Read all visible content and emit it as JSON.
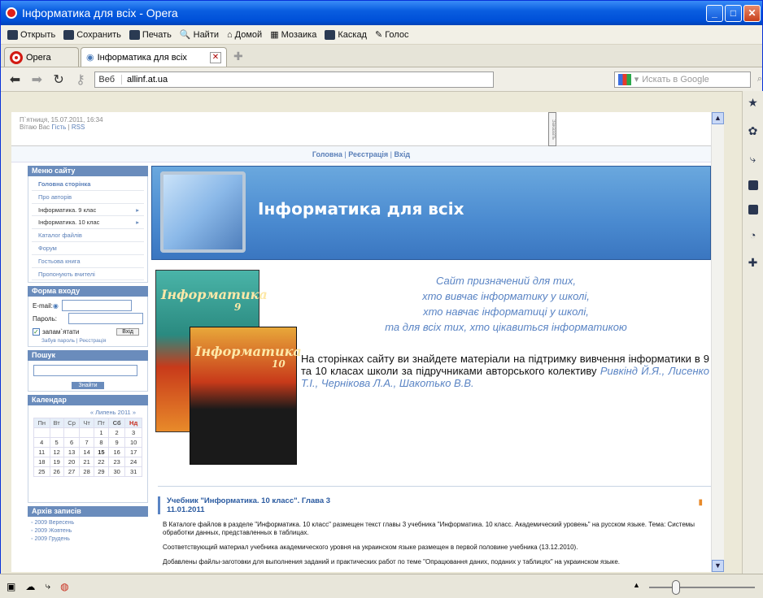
{
  "window": {
    "title": "Інформатика для всіх - Opera"
  },
  "menubar": {
    "items": [
      "Открыть",
      "Сохранить",
      "Печать",
      "Найти",
      "Домой",
      "Мозаика",
      "Каскад",
      "Голос"
    ]
  },
  "tabs": {
    "opera_label": "Opera",
    "page_label": "Інформатика для всіх"
  },
  "nav": {
    "web_label": "Веб",
    "url": "allinf.at.ua",
    "search_placeholder": "Искать в Google"
  },
  "site": {
    "date": "П`ятниця, 15.07.2011, 16:34",
    "greeting": "Вітаю Вас",
    "guest": "Гість",
    "rss": "RSS",
    "vertical_text": "Заказать",
    "topnav": {
      "home": "Головна",
      "register": "Реєстрація",
      "login": "Вхід"
    },
    "menu_title": "Меню сайту",
    "menu": [
      "Головна сторінка",
      "Про авторів",
      "Інформатика. 9 клас",
      "Інформатика. 10 клас",
      "Каталог файлів",
      "Форум",
      "Гостьова книга",
      "Пропонують вчителі"
    ],
    "login_title": "Форма входу",
    "email_label": "E-mail:",
    "password_label": "Пароль:",
    "remember_label": "запам`ятати",
    "login_button": "Вхід",
    "forgot": "Забув пароль",
    "register": "Реєстрація",
    "search_title": "Пошук",
    "search_button": "Знайти",
    "calendar_title": "Календар",
    "calendar_month": "Липень 2011",
    "calendar_days": [
      "Пн",
      "Вт",
      "Ср",
      "Чт",
      "Пт",
      "Сб",
      "Нд"
    ],
    "calendar_rows": [
      [
        "",
        "",
        "",
        "",
        "1",
        "2",
        "3"
      ],
      [
        "4",
        "5",
        "6",
        "7",
        "8",
        "9",
        "10"
      ],
      [
        "11",
        "12",
        "13",
        "14",
        "15",
        "16",
        "17"
      ],
      [
        "18",
        "19",
        "20",
        "21",
        "22",
        "23",
        "24"
      ],
      [
        "25",
        "26",
        "27",
        "28",
        "29",
        "30",
        "31"
      ]
    ],
    "archive_title": "Архів записів",
    "archive": [
      "2009 Вересень",
      "2009 Жовтень",
      "2009 Грудень"
    ],
    "banner_title": "Інформатика для всіх",
    "book1_title": "Інформатика",
    "book1_grade": "9",
    "book2_title": "Інформатика",
    "book2_grade": "10",
    "intro_lines": [
      "Сайт призначений для тих,",
      "хто вивчає інформатику у школі,",
      "хто навчає інформатиці у школі,",
      "та для всіх тих, хто цікавиться інформатикою"
    ],
    "intro_text": "На сторінках сайту ви знайдете матеріали на підтримку вивчення інформатики в 9 та 10 класах школи за підручниками авторського колективу",
    "authors": "Ривкінд Й.Я., Лисенко Т.І., Чернікова Л.А., Шакотько В.В.",
    "news_title": "Учебник \"Информатика. 10 класс\". Глава 3",
    "news_date": "11.01.2011",
    "news_p1": "В Каталоге файлов в разделе \"Информатика. 10 класс\" размещен текст главы 3 учебника \"Информатика. 10 класс. Академический уровень\" на русском языке. Тема: Системы обработки данных, представленных в таблицах.",
    "news_p2": "Соответствующий материал учебника академического уровня на украинском языке размещен в первой половине учебника (13.12.2010).",
    "news_p3": "Добавлены файлы-заготовки для выполнения заданий и практических работ по теме \"Опрацювання даних, поданих у таблицях\" на украинском языке."
  }
}
